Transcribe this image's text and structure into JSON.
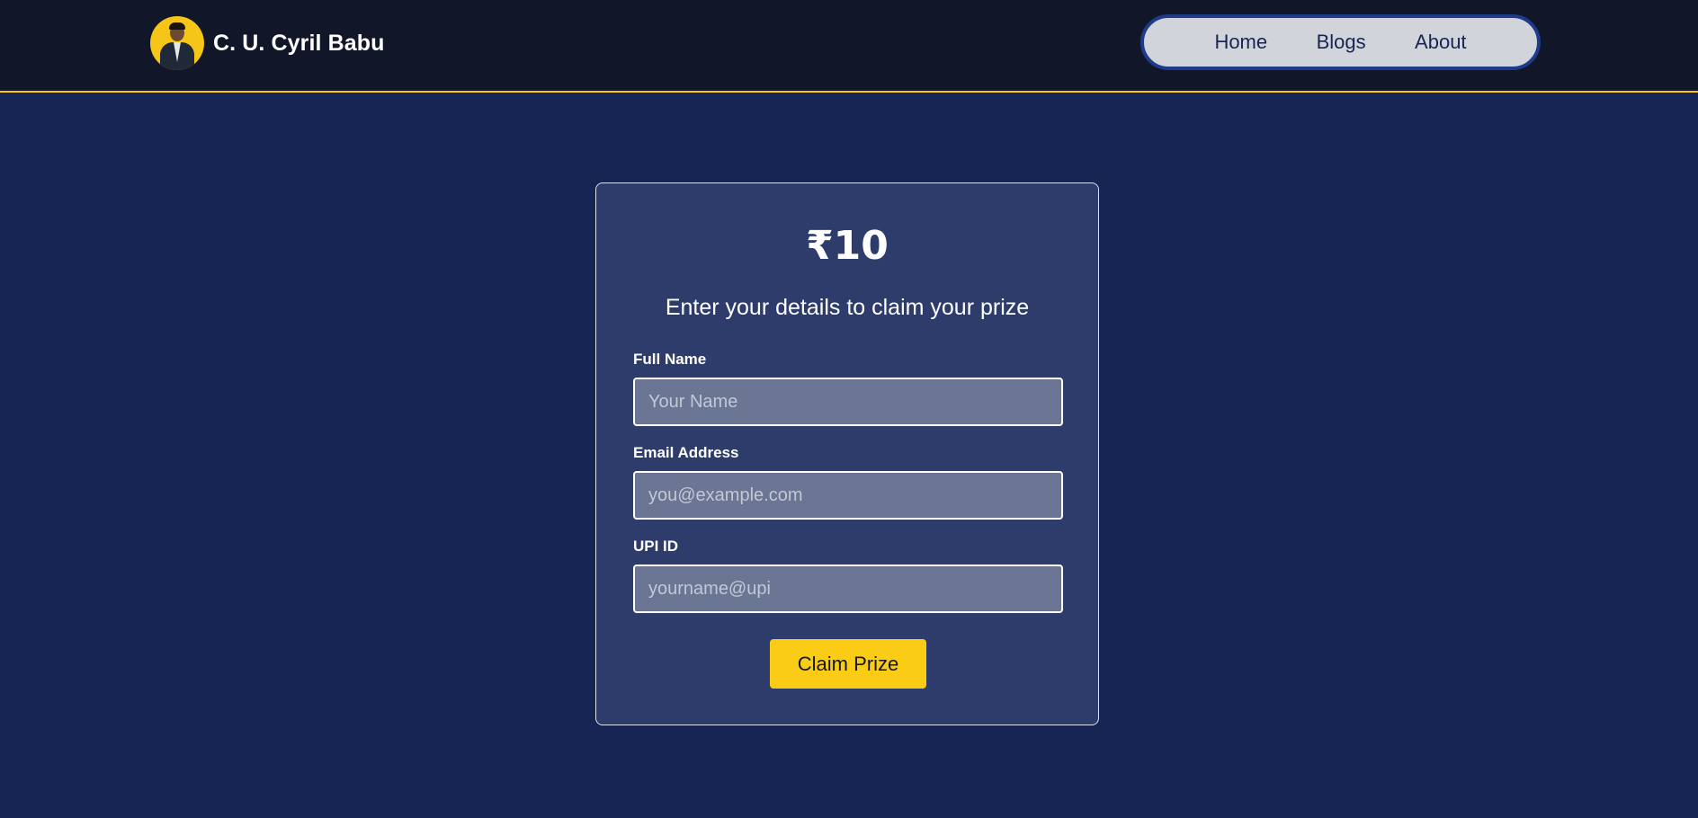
{
  "header": {
    "brand_name": "C. U. Cyril Babu",
    "nav": [
      {
        "label": "Home"
      },
      {
        "label": "Blogs"
      },
      {
        "label": "About"
      }
    ]
  },
  "card": {
    "prize_amount": "₹10",
    "subtitle": "Enter your details to claim your prize",
    "fields": [
      {
        "label": "Full Name",
        "placeholder": "Your Name",
        "value": ""
      },
      {
        "label": "Email Address",
        "placeholder": "you@example.com",
        "value": ""
      },
      {
        "label": "UPI ID",
        "placeholder": "yourname@upi",
        "value": ""
      }
    ],
    "submit_label": "Claim Prize"
  },
  "colors": {
    "page_background": "#172554",
    "navbar_background": "#111629",
    "accent_yellow": "#facc15",
    "card_background": "#2e3c6b",
    "nav_pill_background": "#d1d5db"
  },
  "icons": {
    "avatar": "profile-photo"
  }
}
